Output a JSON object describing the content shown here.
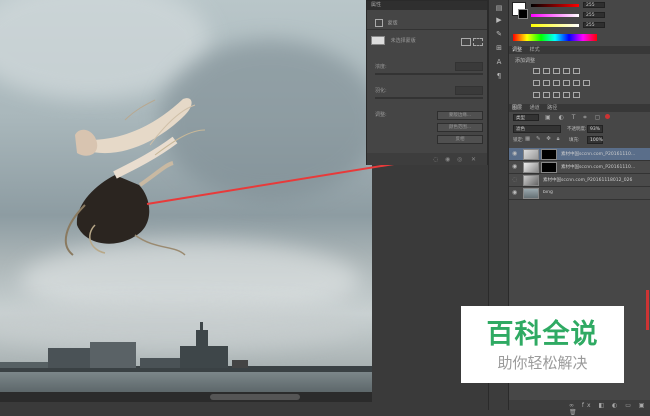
{
  "properties": {
    "title": "属性",
    "mask_label": "蒙版",
    "mask_none": "未选择蒙版",
    "density": "浓度:",
    "feather": "羽化:",
    "refine": "调整:",
    "btn_mask_edge": "蒙版边缘...",
    "btn_color_range": "颜色范围...",
    "btn_invert": "反相"
  },
  "color": {
    "r": "255",
    "g": "255",
    "b": "255"
  },
  "adjustments": {
    "tabs": [
      "调整",
      "样式"
    ],
    "add_label": "添加调整"
  },
  "layers": {
    "tabs": [
      "图层",
      "通道",
      "路径"
    ],
    "filter_kind": "类型",
    "blend_mode": "滤色",
    "opacity_label": "不透明度:",
    "opacity_value": "93%",
    "lock_label": "锁定:",
    "fill_label": "填充:",
    "fill_value": "100%",
    "rows": [
      {
        "name": "素材中国sccnn.com_P20161110..."
      },
      {
        "name": "素材中国sccnn.com_P20161110..."
      },
      {
        "name": "素材中国sccnn.com_P20161118012_026"
      },
      {
        "name": "bing"
      }
    ]
  },
  "watermark": {
    "line1": "百科全说",
    "line2": "助你轻松解决"
  },
  "colors": {
    "accent_red": "#e83a3a",
    "brand_green": "#2faa63"
  }
}
